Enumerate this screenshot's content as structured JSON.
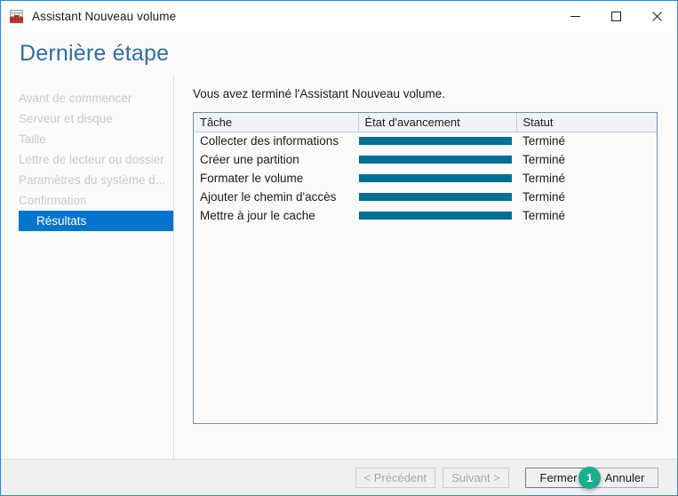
{
  "window": {
    "title": "Assistant Nouveau volume",
    "icon": "wizard-toolbox-icon",
    "controls": {
      "minimize": "─",
      "maximize": "☐",
      "close": "✕"
    },
    "border_color": "#2b88d8"
  },
  "header": {
    "title": "Dernière étape",
    "title_color": "#2f6f9f"
  },
  "sidebar": {
    "items": [
      {
        "label": "Avant de commencer",
        "active": false
      },
      {
        "label": "Serveur et disque",
        "active": false
      },
      {
        "label": "Taille",
        "active": false
      },
      {
        "label": "Lettre de lecteur ou dossier",
        "active": false
      },
      {
        "label": "Paramètres du système d...",
        "active": false
      },
      {
        "label": "Confirmation",
        "active": false
      },
      {
        "label": "Résultats",
        "active": true
      }
    ],
    "active_bg": "#0374cd",
    "inactive_color": "#c8c8c8"
  },
  "main": {
    "intro": "Vous avez terminé l'Assistant Nouveau volume.",
    "table": {
      "headers": {
        "task": "Tâche",
        "progress": "État d'avancement",
        "status": "Statut"
      },
      "progress_color": "#006f94",
      "rows": [
        {
          "task": "Collecter des informations",
          "progress": 100,
          "status": "Terminé"
        },
        {
          "task": "Créer une partition",
          "progress": 100,
          "status": "Terminé"
        },
        {
          "task": "Formater le volume",
          "progress": 100,
          "status": "Terminé"
        },
        {
          "task": "Ajouter le chemin d'accès",
          "progress": 100,
          "status": "Terminé"
        },
        {
          "task": "Mettre à jour le cache",
          "progress": 100,
          "status": "Terminé"
        }
      ]
    }
  },
  "footer": {
    "previous": "< Précédent",
    "next": "Suivant >",
    "close": "Fermer",
    "cancel": "Annuler"
  },
  "annotation": {
    "badge_number": "1",
    "badge_color": "#17b08a"
  }
}
